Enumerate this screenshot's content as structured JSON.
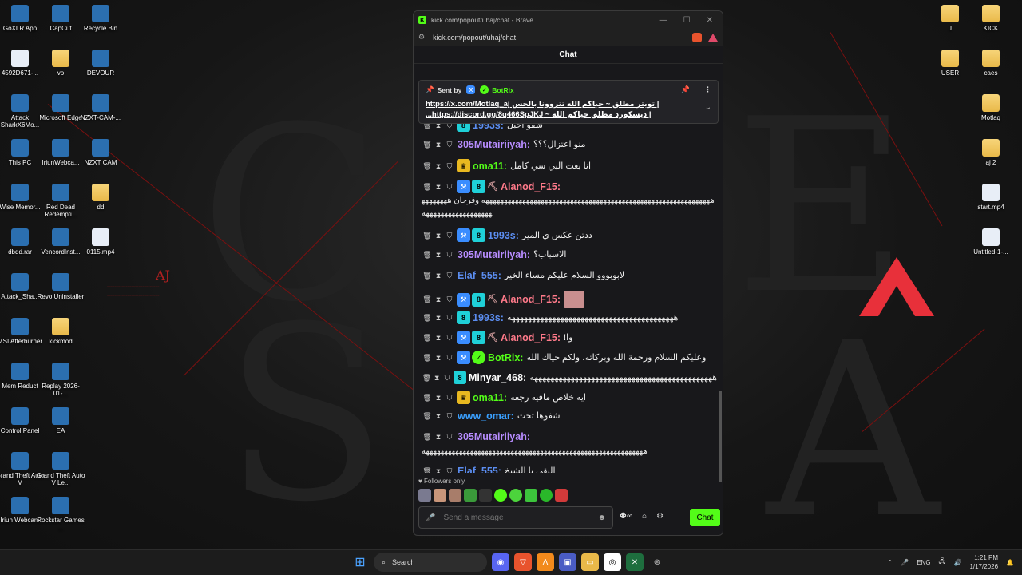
{
  "window": {
    "title": "kick.com/popout/uhaj/chat - Brave",
    "url": "kick.com/popout/uhaj/chat",
    "heading": "Chat"
  },
  "pinned": {
    "sent_by": "Sent by",
    "bot": "BotRix",
    "line1": "| تويتر مطلق ~ حياكم الله تتروونا بالحس https://x.com/Motlaq_aj",
    "line2": "| ديسكورد مطلق حياكم الله ~ https://discord.gg/8q466SpJKJ..."
  },
  "messages": [
    {
      "user": "1993s",
      "color": "#5b8df0",
      "text": "شفو اخبل",
      "badges": [
        "kick"
      ]
    },
    {
      "user": "305Mutairiiyah",
      "color": "#b78cff",
      "text": "منو اعتزال؟؟؟",
      "badges": []
    },
    {
      "user": "oma11",
      "color": "#53fc18",
      "text": "انا بعت البي سي كامل",
      "badges": [
        "sub"
      ]
    },
    {
      "user": "Alanod_F15",
      "color": "#ff7a8a",
      "text": "",
      "badges": [
        "mod",
        "kick",
        "pick"
      ]
    },
    {
      "user": "1993s",
      "color": "#5b8df0",
      "text": "ددتن عكس ي المير",
      "badges": [
        "mod",
        "kick"
      ]
    },
    {
      "user": "305Mutairiiyah",
      "color": "#b78cff",
      "text": "الاسباب؟",
      "badges": []
    },
    {
      "user": "Elaf_555",
      "color": "#5b8df0",
      "text": "لابوبووو السلام عليكم مساء الخير",
      "badges": []
    },
    {
      "user": "Alanod_F15",
      "color": "#ff7a8a",
      "text": "",
      "badges": [
        "mod",
        "kick",
        "pick"
      ]
    },
    {
      "user": "1993s",
      "color": "#5b8df0",
      "text": "هههههههههههههههههههههههههههههههههههههههههه",
      "badges": [
        "kick"
      ]
    },
    {
      "user": "Alanod_F15",
      "color": "#ff7a8a",
      "text": "وا!",
      "badges": [
        "mod",
        "kick",
        "pick"
      ]
    },
    {
      "user": "BotRix",
      "color": "#53fc18",
      "text": "وعليكم السلام ورحمة الله وبركاته، ولكم حياك الله",
      "badges": [
        "mod",
        "ver"
      ]
    },
    {
      "user": "Minyar_468",
      "color": "#ffffff",
      "text": "هههههههههههههههههههههههههههههههههههههههههههههه",
      "badges": [
        "kick"
      ]
    },
    {
      "user": "oma11",
      "color": "#53fc18",
      "text": "ايه خلاص مافيه رجعه",
      "badges": [
        "sub"
      ]
    },
    {
      "user": "www_omar",
      "color": "#3aa0ff",
      "text": "شفوها تحت",
      "badges": []
    },
    {
      "user": "305Mutairiiyah",
      "color": "#b78cff",
      "text": "",
      "badges": []
    },
    {
      "user": "Elaf_555",
      "color": "#5b8df0",
      "text": "البقى يا الشيخ",
      "badges": []
    }
  ],
  "wrapped": {
    "alanod1": "ههههههههههههههههههههههههههههههههههههههههههههههههههههههههههههههه وفرحان ههههههههههههههههههههههههههه",
    "mut": "ههههههههههههههههههههههههههههههههههههههههههههههههههههههههههههه"
  },
  "footer": {
    "followers": "Followers only",
    "placeholder": "Send a message",
    "chat_button": "Chat"
  },
  "desktop_left": [
    {
      "label": "GoXLR App",
      "icon": "goxlr-icon"
    },
    {
      "label": "CapCut",
      "icon": "capcut-icon"
    },
    {
      "label": "Recycle Bin",
      "icon": "recycle-bin-icon"
    },
    {
      "label": "4592D671-...",
      "icon": "file-icon"
    },
    {
      "label": "vo",
      "icon": "folder-icon"
    },
    {
      "label": "DEVOUR",
      "icon": "devour-icon"
    },
    {
      "label": "Attack SharkX6Mo...",
      "icon": "attack-shark-icon"
    },
    {
      "label": "Microsoft Edge",
      "icon": "edge-icon"
    },
    {
      "label": "NZXT-CAM-...",
      "icon": "nzxt-icon"
    },
    {
      "label": "This PC",
      "icon": "pc-icon"
    },
    {
      "label": "IriunWebca...",
      "icon": "iriun-icon"
    },
    {
      "label": "NZXT CAM",
      "icon": "nzxt-icon"
    },
    {
      "label": "Wise Memor...",
      "icon": "wise-icon"
    },
    {
      "label": "Red Dead Redempti...",
      "icon": "rdr-icon"
    },
    {
      "label": "dd",
      "icon": "folder-icon"
    },
    {
      "label": "dbdd.rar",
      "icon": "rar-icon"
    },
    {
      "label": "VencordInst...",
      "icon": "vencord-icon"
    },
    {
      "label": "0115.mp4",
      "icon": "file-icon"
    },
    {
      "label": "Attack_Sha...",
      "icon": "attack-shark-icon"
    },
    {
      "label": "Revo Uninstaller",
      "icon": "revo-icon"
    },
    {
      "label": "MSI Afterburner",
      "icon": "msi-icon"
    },
    {
      "label": "kickmod",
      "icon": "folder-icon"
    },
    {
      "label": "Mem Reduct",
      "icon": "mem-icon"
    },
    {
      "label": "Replay 2026-01-...",
      "icon": "capcut-icon"
    },
    {
      "label": "Control Panel",
      "icon": "control-panel-icon"
    },
    {
      "label": "EA",
      "icon": "ea-icon"
    },
    {
      "label": "Grand Theft Auto V",
      "icon": "gta-icon"
    },
    {
      "label": "Grand Theft Auto V Le...",
      "icon": "gta-icon"
    },
    {
      "label": "Iriun Webcam",
      "icon": "iriun-icon"
    },
    {
      "label": "Rockstar Games ...",
      "icon": "rockstar-icon"
    }
  ],
  "desktop_right": [
    {
      "label": "J",
      "icon": "folder-icon"
    },
    {
      "label": "KICK",
      "icon": "folder-icon"
    },
    {
      "label": "USER",
      "icon": "folder-icon"
    },
    {
      "label": "caes",
      "icon": "folder-icon"
    },
    {
      "label": "Motlaq",
      "icon": "folder-icon"
    },
    {
      "label": "aj 2",
      "icon": "folder-icon"
    },
    {
      "label": "start.mp4",
      "icon": "file-icon"
    },
    {
      "label": "Untitled-1-...",
      "icon": "file-icon"
    }
  ],
  "wallpaper": {
    "aj": "AJ"
  },
  "taskbar": {
    "search": "Search",
    "lang": "ENG",
    "time": "1:21 PM",
    "date": "1/17/2026"
  }
}
